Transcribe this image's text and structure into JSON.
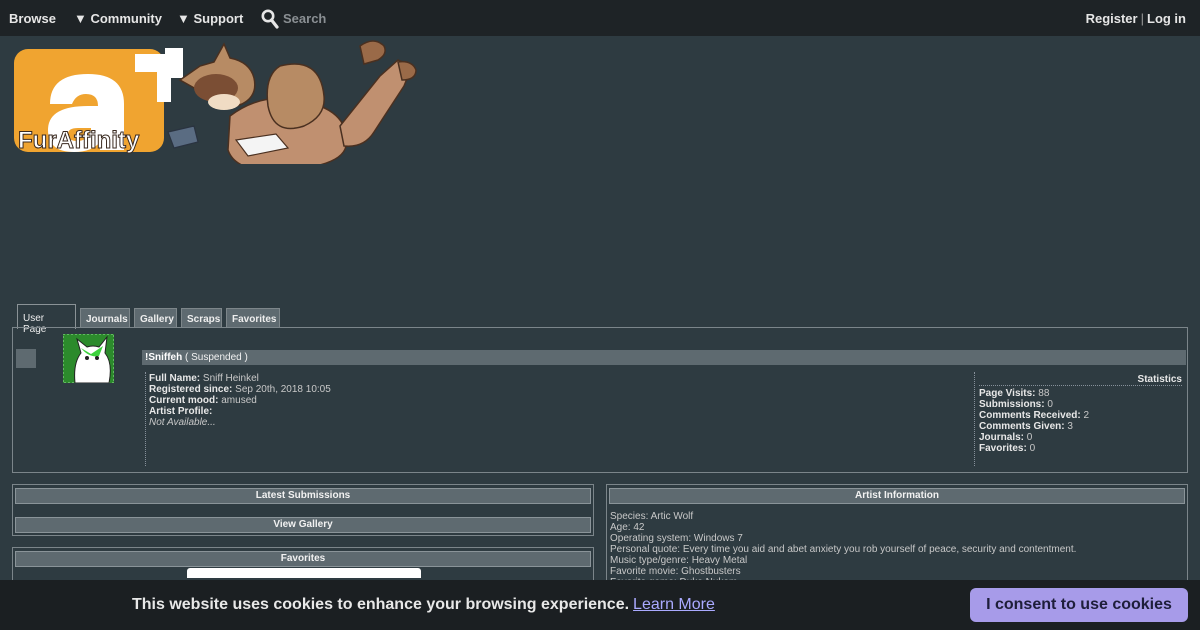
{
  "nav": {
    "browse": "Browse",
    "community": "▼ Community",
    "support": "▼ Support",
    "search_placeholder": "Search",
    "register": "Register",
    "separator": "|",
    "login": "Log in"
  },
  "banner": {
    "logo_text": "FurAffinity"
  },
  "tabs": [
    "User Page",
    "Journals",
    "Gallery",
    "Scraps",
    "Favorites"
  ],
  "profile": {
    "username": "!Sniffeh",
    "status": "( Suspended )",
    "full_name_label": "Full Name:",
    "full_name": "Sniff Heinkel",
    "registered_label": "Registered since:",
    "registered": "Sep 20th, 2018 10:05",
    "mood_label": "Current mood:",
    "mood": "amused",
    "artist_profile_label": "Artist Profile:",
    "artist_profile": "Not Available..."
  },
  "stats": {
    "title": "Statistics",
    "items": [
      {
        "label": "Page Visits:",
        "value": "88"
      },
      {
        "label": "Submissions:",
        "value": "0"
      },
      {
        "label": "Comments Received:",
        "value": "2"
      },
      {
        "label": "Comments Given:",
        "value": "3"
      },
      {
        "label": "Journals:",
        "value": "0"
      },
      {
        "label": "Favorites:",
        "value": "0"
      }
    ]
  },
  "latest_submissions": {
    "title": "Latest Submissions",
    "view_gallery": "View Gallery"
  },
  "favorites": {
    "title": "Favorites"
  },
  "artist_info": {
    "title": "Artist Information",
    "lines": [
      "Species: Artic Wolf",
      "Age: 42",
      "Operating system: Windows 7",
      "Personal quote: Every time you aid and abet anxiety you rob yourself of peace, security and contentment.",
      "Music type/genre: Heavy Metal",
      "Favorite movie: Ghostbusters",
      "Favorite game: Duke Nukem"
    ]
  },
  "cookie": {
    "text": "This website uses cookies to enhance your browsing experience.",
    "learn_more": "Learn More",
    "consent": "I consent to use cookies"
  },
  "colors": {
    "page_bg": "#2e3b41",
    "nav_bg": "#1e2326",
    "bar_bg": "#5e6a70",
    "logo_orange": "#f0a430",
    "consent_button": "#a79be9"
  }
}
